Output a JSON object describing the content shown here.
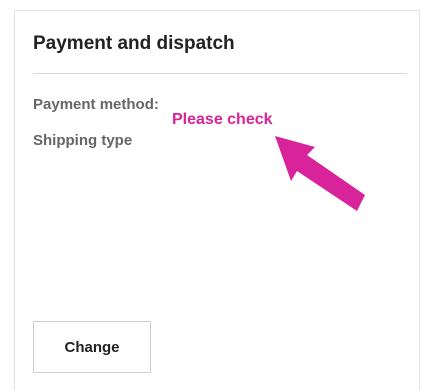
{
  "panel": {
    "title": "Payment and dispatch",
    "fields": [
      {
        "label": "Payment method:"
      },
      {
        "label": "Shipping type"
      }
    ],
    "change_label": "Change"
  },
  "annotation": {
    "text": "Please check",
    "color": "#d8239a",
    "arrow_icon": "arrow-up-left-icon"
  }
}
